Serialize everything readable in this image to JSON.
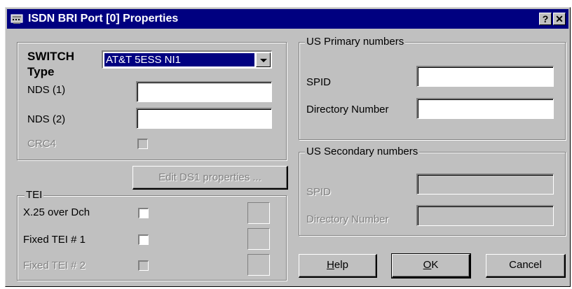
{
  "window": {
    "title": "ISDN BRI Port [0]  Properties",
    "help_glyph": "?",
    "close_glyph": "✕"
  },
  "switch_group": {
    "switch_label_line1": "SWITCH",
    "switch_label_line2": "Type",
    "switch_type_value": "AT&T 5ESS NI1",
    "nds1_label": "NDS (1)",
    "nds1_value": "",
    "nds2_label": "NDS (2)",
    "nds2_value": "",
    "crc4_label": "CRC4",
    "crc4_checked": false
  },
  "edit_ds1_button": "Edit DS1 properties ...",
  "tei_group": {
    "legend": "TEI",
    "x25_label": "X.25 over Dch",
    "x25_checked": false,
    "fixed1_label": "Fixed TEI # 1",
    "fixed1_checked": false,
    "fixed2_label": "Fixed TEI # 2",
    "fixed2_checked": false
  },
  "us_primary": {
    "legend": "US Primary numbers",
    "spid_label": "SPID",
    "spid_value": "",
    "dn_label": "Directory Number",
    "dn_value": ""
  },
  "us_secondary": {
    "legend": "US Secondary numbers",
    "spid_label": "SPID",
    "spid_value": "",
    "dn_label": "Directory Number",
    "dn_value": ""
  },
  "buttons": {
    "help_first": "H",
    "help_rest": "elp",
    "ok_first": "O",
    "ok_rest": "K",
    "cancel": "Cancel"
  }
}
